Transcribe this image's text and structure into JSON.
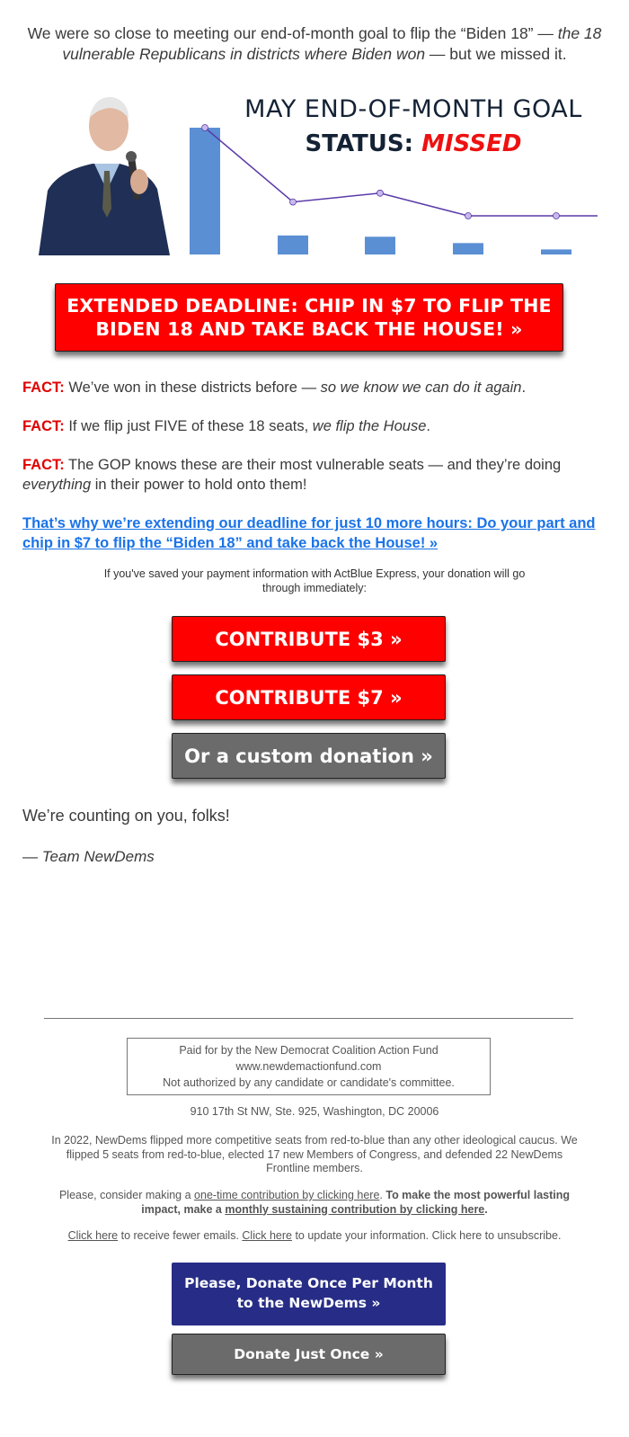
{
  "intro": {
    "text_start": "We were so close to meeting our end-of-month goal to flip the “Biden 18” — ",
    "text_italic": "the 18 vulnerable Republicans in districts where Biden won",
    "text_end": " — but we missed it."
  },
  "hero": {
    "title_line1": "MAY END-OF-MONTH GOAL",
    "status_label": "STATUS: ",
    "status_value": "MISSED",
    "photo_alt": "Joe Biden speaking into microphone",
    "colors": {
      "bar": "#5b8fd4",
      "line": "#5a3aa8",
      "marker": "#c7b8ee",
      "status": "#ee1111",
      "title": "#142235"
    },
    "bars": [
      1.0,
      0.15,
      0.14,
      0.09,
      0.04
    ],
    "line": [
      1.0,
      0.41,
      0.48,
      0.3,
      0.3
    ]
  },
  "main_button": {
    "label": "EXTENDED DEADLINE: CHIP IN $7 TO FLIP THE BIDEN 18 AND TAKE BACK THE HOUSE! »"
  },
  "facts": [
    {
      "label": "FACT:",
      "text": " We’ve won in these districts before — ",
      "italic": "so we know we can do it again",
      "tail": "."
    },
    {
      "label": "FACT:",
      "text": " If we flip just FIVE of these 18 seats, ",
      "italic": "we flip the House",
      "tail": "."
    },
    {
      "label": "FACT:",
      "text": " The GOP knows these are their most vulnerable seats — and they’re doing ",
      "italic": "everything",
      "tail": " in their power to hold onto them!"
    }
  ],
  "cta_link": "That’s why we’re extending our deadline for just 10 more hours: Do your part and chip in $7 to flip the “Biden 18” and take back the House! »",
  "express_note": "If you've saved your payment information with ActBlue Express, your donation will go through immediately:",
  "donate_buttons": {
    "c3": "CONTRIBUTE $3 »",
    "c7": "CONTRIBUTE $7 »",
    "custom": "Or a custom donation »"
  },
  "closing": "We’re counting on you, folks!",
  "signoff": {
    "dash": "— ",
    "name": "Team NewDems"
  },
  "footer": {
    "disclaimer_line1": "Paid for by the New Democrat Coalition Action Fund",
    "disclaimer_line2": "www.newdemactionfund.com",
    "disclaimer_line3": "Not authorized by any candidate or candidate's committee.",
    "address": "910 17th St NW, Ste. 925, Washington, DC 20006",
    "about": "In 2022, NewDems flipped more competitive seats from red-to-blue than any other ideological caucus. We flipped 5 seats from red-to-blue, elected 17 new Members of Congress, and defended 22 NewDems Frontline members.",
    "consider_start": "Please, consider making a ",
    "consider_link": "one-time contribution by clicking here",
    "consider_mid": ". ",
    "consider_bold": "To make the most powerful lasting impact, make a ",
    "consider_bold_link": "monthly sustaining contribution by clicking here",
    "consider_end": ".",
    "fewer_link": "Click here",
    "fewer_text": " to receive fewer emails. ",
    "update_link": "Click here",
    "update_text": " to update your information. Click here to unsubscribe.",
    "monthly_button": "Please, Donate Once Per Month to the NewDems »",
    "once_button": "Donate Just Once »"
  }
}
